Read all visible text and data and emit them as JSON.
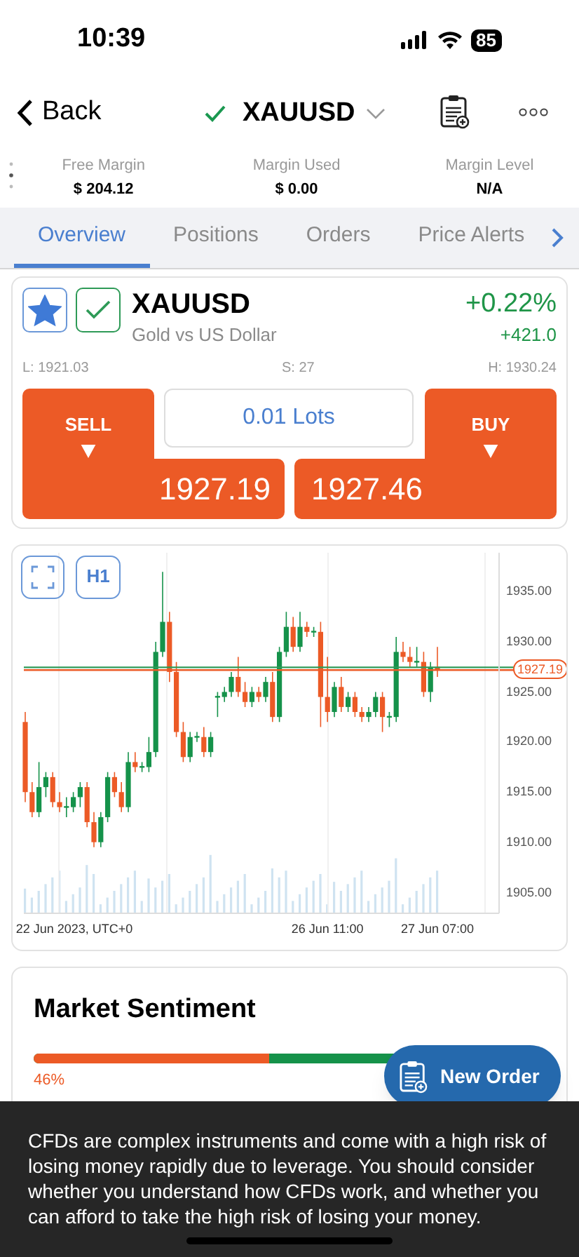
{
  "status_bar": {
    "time": "10:39",
    "battery": "85"
  },
  "nav": {
    "back": "Back",
    "symbol": "XAUUSD"
  },
  "account": [
    {
      "label": "Free Margin",
      "value": "$ 204.12"
    },
    {
      "label": "Margin Used",
      "value": "$ 0.00"
    },
    {
      "label": "Margin Level",
      "value": "N/A"
    }
  ],
  "tabs": [
    {
      "label": "Overview",
      "selected": true
    },
    {
      "label": "Positions",
      "selected": false
    },
    {
      "label": "Orders",
      "selected": false
    },
    {
      "label": "Price Alerts",
      "selected": false
    }
  ],
  "instrument": {
    "symbol": "XAUUSD",
    "description": "Gold vs US Dollar",
    "favorite": true,
    "change_pct": "+0.22%",
    "change_points": "+421.0",
    "low": "L: 1921.03",
    "spread": "S: 27",
    "high": "H: 1930.24"
  },
  "trade": {
    "sell_label": "SELL",
    "sell_price": "1927.19",
    "lots": "0.01 Lots",
    "buy_label": "BUY",
    "buy_price": "1927.46"
  },
  "chart": {
    "timeframe": "H1",
    "current_price": "1927.19",
    "chart_data": {
      "type": "candlestick",
      "ylim": [
        1902.9,
        1938.9
      ],
      "ref_lines": [
        {
          "axis": "y",
          "value": 1927.46,
          "color": "#2e9a57"
        },
        {
          "axis": "y",
          "value": 1927.19,
          "color": "#ec5a26"
        }
      ],
      "categories": [
        null,
        null,
        null,
        null,
        null,
        null,
        null,
        "22 Jun 2023, UTC+0",
        null,
        null,
        null,
        null,
        null,
        null,
        null,
        null,
        null,
        null,
        null,
        null,
        null,
        null,
        null,
        null,
        null,
        null,
        null,
        null,
        null,
        null,
        null,
        null,
        null,
        null,
        null,
        null,
        null,
        null,
        null,
        null,
        null,
        null,
        null,
        null,
        "26 Jun 11:00",
        null,
        null,
        null,
        null,
        null,
        null,
        null,
        null,
        null,
        null,
        null,
        null,
        null,
        null,
        null,
        "27 Jun 07:00"
      ],
      "ohlc": [
        [
          1922,
          1923,
          1914,
          1915
        ],
        [
          1915,
          1916,
          1912.5,
          1913
        ],
        [
          1913,
          1918,
          1912.5,
          1915.5
        ],
        [
          1915.5,
          1917,
          1914.5,
          1916.5
        ],
        [
          1916.5,
          1917,
          1913.5,
          1914
        ],
        [
          1914,
          1915,
          1913,
          1913.5
        ],
        [
          1913.5,
          1914.5,
          1912.5,
          1913.6
        ],
        [
          1913.5,
          1915,
          1913,
          1914.5
        ],
        [
          1914.5,
          1916,
          1913.5,
          1915.5
        ],
        [
          1915.5,
          1916,
          1911.5,
          1912
        ],
        [
          1912,
          1913,
          1909.5,
          1910
        ],
        [
          1910,
          1913,
          1909.5,
          1912.5
        ],
        [
          1912.5,
          1917,
          1912,
          1916.5
        ],
        [
          1916.5,
          1917,
          1914.5,
          1915
        ],
        [
          1915,
          1916,
          1913,
          1913.5
        ],
        [
          1913.5,
          1919,
          1913,
          1918
        ],
        [
          1918,
          1919,
          1917,
          1917.5
        ],
        [
          1917.5,
          1918,
          1917,
          1917.6
        ],
        [
          1917.5,
          1920.5,
          1917,
          1919
        ],
        [
          1919,
          1930,
          1918.5,
          1929
        ],
        [
          1929,
          1937,
          1928.5,
          1932
        ],
        [
          1932,
          1933,
          1926,
          1927
        ],
        [
          1927,
          1928,
          1920.5,
          1921
        ],
        [
          1921,
          1922,
          1918,
          1918.5
        ],
        [
          1918.5,
          1921,
          1918,
          1920.5
        ],
        [
          1920.5,
          1921,
          1920,
          1920.6
        ],
        [
          1920.5,
          1921.5,
          1918.5,
          1919
        ],
        [
          1919,
          1921,
          1918.5,
          1920.5
        ],
        [
          1924.5,
          1925,
          1922.5,
          1924.6
        ],
        [
          1924.5,
          1925.5,
          1924,
          1925
        ],
        [
          1925,
          1927,
          1924.5,
          1926.5
        ],
        [
          1926.5,
          1928.5,
          1924.5,
          1925
        ],
        [
          1925,
          1926,
          1923.5,
          1924
        ],
        [
          1924,
          1925.5,
          1923.5,
          1925
        ],
        [
          1925,
          1925.5,
          1924,
          1924.5
        ],
        [
          1924.5,
          1926.5,
          1924,
          1926
        ],
        [
          1926,
          1927,
          1922,
          1922.5
        ],
        [
          1922.5,
          1929.5,
          1922,
          1929
        ],
        [
          1929,
          1933,
          1928.5,
          1931.5
        ],
        [
          1931.5,
          1932.5,
          1929,
          1929.5
        ],
        [
          1929.5,
          1933,
          1929,
          1931.5
        ],
        [
          1931.5,
          1932,
          1930.5,
          1931
        ],
        [
          1931,
          1931.5,
          1930.5,
          1931.1
        ],
        [
          1931,
          1932,
          1921.5,
          1924.5
        ],
        [
          1924.5,
          1928.5,
          1922,
          1923
        ],
        [
          1923,
          1926,
          1922.5,
          1925.5
        ],
        [
          1925.5,
          1926.5,
          1923,
          1923.5
        ],
        [
          1923.5,
          1925,
          1923,
          1924.5
        ],
        [
          1924.5,
          1925,
          1922.5,
          1923
        ],
        [
          1923,
          1923.5,
          1922,
          1922.5
        ],
        [
          1922.5,
          1923.5,
          1922,
          1923
        ],
        [
          1923,
          1925,
          1922.5,
          1924.5
        ],
        [
          1924.5,
          1925,
          1921,
          1922.5
        ],
        [
          1922.5,
          1923,
          1921.5,
          1922.6
        ],
        [
          1922.5,
          1930.5,
          1922,
          1929
        ],
        [
          1929,
          1930,
          1928,
          1928.5
        ],
        [
          1928.5,
          1929.5,
          1927.5,
          1928
        ],
        [
          1928,
          1929.5,
          1927.5,
          1928.1
        ],
        [
          1928,
          1929,
          1924.5,
          1925
        ],
        [
          1925,
          1928,
          1924,
          1927.5
        ],
        [
          1927.5,
          1929.5,
          1926.5,
          1927.2
        ]
      ],
      "yticks": [
        {
          "value": 1935,
          "label": "1935.00"
        },
        {
          "value": 1930,
          "label": "1930.00"
        },
        {
          "value": 1925,
          "label": "1925.00"
        },
        {
          "value": 1920,
          "label": "1920.00"
        },
        {
          "value": 1915,
          "label": "1915.00"
        },
        {
          "value": 1910,
          "label": "1910.00"
        },
        {
          "value": 1905,
          "label": "1905.00"
        }
      ]
    }
  },
  "sentiment": {
    "title": "Market Sentiment",
    "level": 0.46,
    "label": "46%"
  },
  "new_order": "New Order",
  "disclaimer": "CFDs are complex instruments and come with a high risk of losing money rapidly due to leverage. You should consider whether you understand how CFDs work, and whether you can afford to take the high risk of losing your money."
}
